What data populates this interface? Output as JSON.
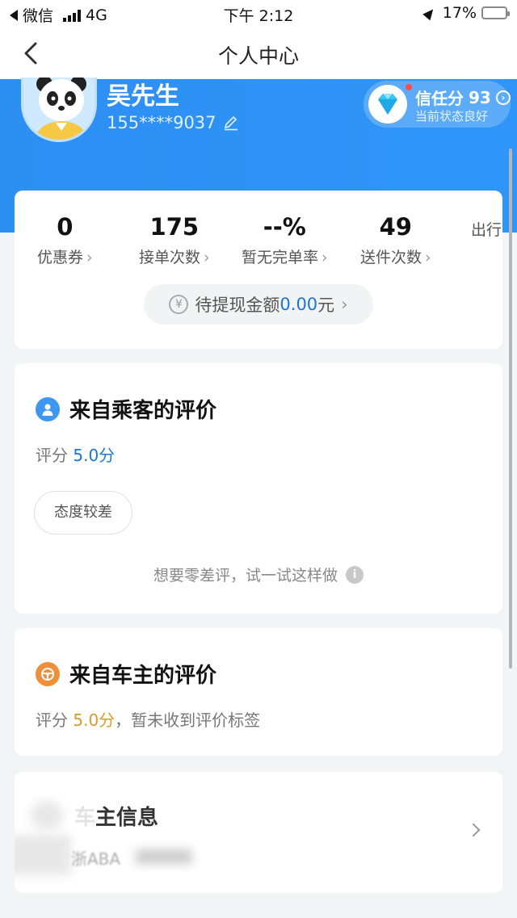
{
  "status_bar": {
    "carrier": "微信",
    "network": "4G",
    "time": "下午 2:12",
    "battery_percent": "17%",
    "battery_level": 0.17,
    "battery_color": "#e53935"
  },
  "nav": {
    "title": "个人中心",
    "back_icon": "chevron-left-icon"
  },
  "profile": {
    "name": "吴先生",
    "phone": "155****9037",
    "edit_icon": "pencil-icon",
    "avatar_icon": "panda-avatar",
    "trust_label": "信任分",
    "trust_score": "93",
    "trust_status": "当前状态良好",
    "brand_color": "#2f93f6"
  },
  "stats": {
    "items": [
      {
        "value": "0",
        "label": "优惠券"
      },
      {
        "value": "175",
        "label": "接单次数"
      },
      {
        "value": "--%",
        "label": "暂无完单率"
      },
      {
        "value": "49",
        "label": "送件次数"
      },
      {
        "value": "",
        "label": "出行"
      }
    ],
    "withdraw_prefix": "待提现金额",
    "withdraw_amount": "0.00",
    "withdraw_suffix": "元"
  },
  "passenger_review": {
    "title": "来自乘客的评价",
    "score_prefix": "评分",
    "score": "5.0分",
    "score_color": "#1976d2",
    "tag": "态度较差",
    "tip": "想要零差评，试一试这样做"
  },
  "owner_review": {
    "title": "来自车主的评价",
    "score_prefix": "评分",
    "score": "5.0分",
    "score_suffix": "，暂未收到评价标签",
    "score_color": "#d99a2b"
  },
  "vehicle": {
    "title_faded": "车",
    "title": "主信息",
    "plate": "浙ABA"
  }
}
